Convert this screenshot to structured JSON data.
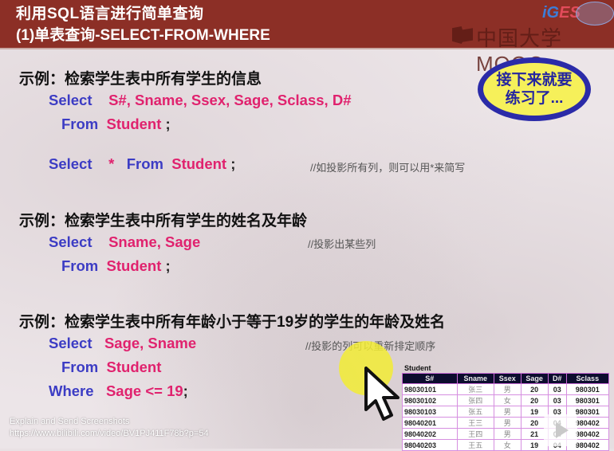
{
  "header": {
    "title_line1": "利用SQL语言进行简单查询",
    "title_line2": "(1)单表查询-SELECT-FROM-WHERE",
    "logo_text": "中国大学MOOC",
    "iges_text_blue": "iG",
    "iges_text_red": "ES"
  },
  "bubble": {
    "line1": "接下来就要",
    "line2": "练习了..."
  },
  "examples": [
    {
      "heading": "示例：检索学生表中所有学生的信息",
      "lines": [
        {
          "kw": "Select",
          "rest": "S#, Sname, Ssex, Sage, Sclass, D#",
          "semi": ""
        },
        {
          "kw": "From",
          "rest": "Student",
          "semi": " ;"
        }
      ],
      "alt": {
        "kw1": "Select",
        "star": "*",
        "kw2": "From",
        "table": "Student",
        "semi": " ;",
        "comment": "//如投影所有列，则可以用*来简写"
      }
    },
    {
      "heading": "示例：检索学生表中所有学生的姓名及年龄",
      "lines": [
        {
          "kw": "Select",
          "rest": "Sname, Sage",
          "semi": ""
        },
        {
          "kw": "From",
          "rest": "Student",
          "semi": " ;"
        }
      ],
      "comment": "//投影出某些列"
    },
    {
      "heading": "示例：检索学生表中所有年龄小于等于19岁的学生的年龄及姓名",
      "lines": [
        {
          "kw": "Select",
          "rest": "Sage, Sname",
          "semi": ""
        },
        {
          "kw": "From",
          "rest": "Student",
          "semi": ""
        },
        {
          "kw": "Where",
          "rest": "Sage <= 19",
          "semi": ";"
        }
      ],
      "comment": "//投影的列可以重新排定顺序"
    }
  ],
  "student_table": {
    "title": "Student",
    "columns": [
      "S#",
      "Sname",
      "Ssex",
      "Sage",
      "D#",
      "Sclass"
    ],
    "rows": [
      [
        "98030101",
        "张三",
        "男",
        "20",
        "03",
        "980301"
      ],
      [
        "98030102",
        "张四",
        "女",
        "20",
        "03",
        "980301"
      ],
      [
        "98030103",
        "张五",
        "男",
        "19",
        "03",
        "980301"
      ],
      [
        "98040201",
        "王三",
        "男",
        "20",
        "04",
        "980402"
      ],
      [
        "98040202",
        "王四",
        "男",
        "21",
        "04",
        "980402"
      ],
      [
        "98040203",
        "王五",
        "女",
        "19",
        "04",
        "980402"
      ]
    ]
  },
  "overlay": {
    "line1": "Explain and Send Screenshots",
    "line2": "https://www.bilibili.com/video/BV1PJ411F78b?p=54"
  },
  "colors": {
    "header_bg": "#8c2f26",
    "keyword": "#3c3cc4",
    "identifier": "#e0226e",
    "bubble_fill": "#f6f05a",
    "bubble_border": "#2b2ba8"
  }
}
